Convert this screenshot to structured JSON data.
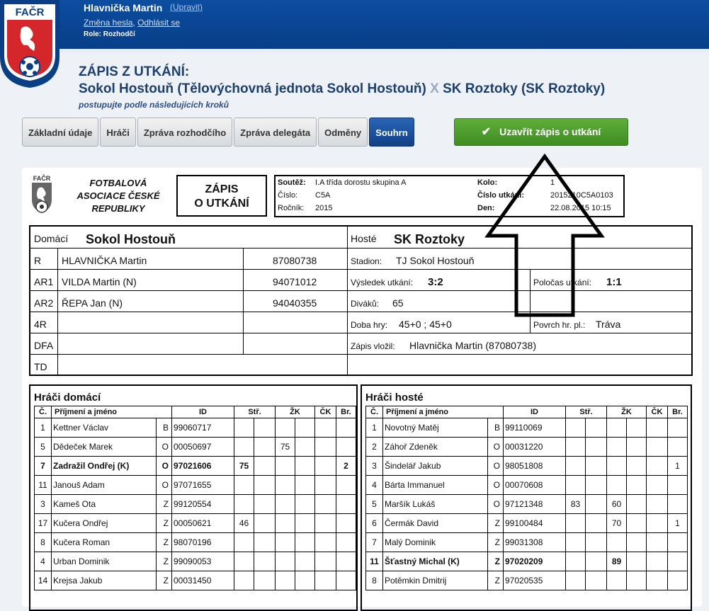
{
  "user": {
    "name": "Hlavnička Martin",
    "edit": "(Upravit)",
    "change_password": "Změna hesla",
    "logout": "Odhlásit se",
    "role": "Role: Rozhodčí",
    "sep": ","
  },
  "logo": {
    "text": "FAČR"
  },
  "page": {
    "title": "ZÁPIS Z UTKÁNÍ:",
    "home": "Sokol Hostouň (Tělovýchovná jednota Sokol Hostouň)",
    "x": "X",
    "away": "SK Roztoky (SK Roztoky)",
    "hint": "postupujte podle následujících kroků"
  },
  "tabs": [
    "Základní údaje",
    "Hráči",
    "Zpráva rozhodčího",
    "Zpráva delegáta",
    "Odměny",
    "Souhrn"
  ],
  "close_button": "Uzavřít zápis o utkání",
  "doc": {
    "fed": "FOTBALOVÁ ASOCIACE ČESKÉ REPUBLIKY",
    "zapis1": "ZÁPIS",
    "zapis2": "O UTKÁNÍ",
    "soutez_l": "Soutěž:",
    "soutez": "I.A třída dorostu skupina A",
    "cislo_l": "Číslo:",
    "cislo": "C5A",
    "rocnik_l": "Ročník:",
    "rocnik": "2015",
    "kolo_l": "Kolo:",
    "kolo": "1",
    "cislo_utkani_l": "Číslo utkání:",
    "cislo_utkani": "2015210C5A0103",
    "den_l": "Den:",
    "den": "22.08.2015 10:15",
    "domaci_l": "Domácí",
    "domaci": "Sokol Hostouň",
    "hoste_l": "Hosté",
    "hoste": "SK Roztoky",
    "officials": [
      {
        "role": "R",
        "name": "HLAVNIČKA Martin",
        "id": "87080738"
      },
      {
        "role": "AR1",
        "name": "VILDA Martin (N)",
        "id": "94071012"
      },
      {
        "role": "AR2",
        "name": "ŘEPA Jan (N)",
        "id": "94040355"
      },
      {
        "role": "4R",
        "name": "",
        "id": ""
      },
      {
        "role": "DFA",
        "name": "",
        "id": ""
      },
      {
        "role": "TD",
        "name": "",
        "id": ""
      }
    ],
    "stadion_l": "Stadion:",
    "stadion": "TJ Sokol Hostouň",
    "vysledek_l": "Výsledek utkání:",
    "vysledek": "3:2",
    "polocas_l": "Poločas utkání:",
    "polocas": "1:1",
    "divaku_l": "Diváků:",
    "divaku": "65",
    "doba_l": "Doba hry:",
    "doba": "45+0 ; 45+0",
    "povrch_l": "Povrch hr. pl.:",
    "povrch": "Tráva",
    "vlozil_l": "Zápis vložil:",
    "vlozil": "Hlavnička Martin (87080738)"
  },
  "home_players": {
    "title": "Hráči domácí",
    "headers": [
      "Č.",
      "Příjmení a jméno",
      "ID",
      "Stř.",
      "",
      "ŽK",
      "",
      "ČK",
      "Br."
    ],
    "rows": [
      [
        "1",
        "Kettner Václav",
        "B",
        "99060717",
        "",
        "",
        "",
        "",
        "",
        ""
      ],
      [
        "5",
        "Dědeček Marek",
        "O",
        "00050697",
        "",
        "",
        "75",
        "",
        "",
        ""
      ],
      [
        "7",
        "Zadražil Ondřej (K)",
        "O",
        "97021606",
        "75",
        "",
        "",
        "",
        "",
        "2"
      ],
      [
        "11",
        "Janouš Adam",
        "O",
        "97071655",
        "",
        "",
        "",
        "",
        "",
        ""
      ],
      [
        "3",
        "Kameš Ota",
        "Z",
        "99120554",
        "",
        "",
        "",
        "",
        "",
        ""
      ],
      [
        "17",
        "Kučera Ondřej",
        "Z",
        "00050621",
        "46",
        "",
        "",
        "",
        "",
        ""
      ],
      [
        "8",
        "Kučera Roman",
        "Z",
        "98070196",
        "",
        "",
        "",
        "",
        "",
        ""
      ],
      [
        "4",
        "Urban Dominik",
        "Z",
        "99090053",
        "",
        "",
        "",
        "",
        "",
        ""
      ],
      [
        "14",
        "Krejsa Jakub",
        "Z",
        "00031450",
        "",
        "",
        "",
        "",
        "",
        ""
      ]
    ]
  },
  "away_players": {
    "title": "Hráči hosté",
    "headers": [
      "Č.",
      "Příjmení a jméno",
      "ID",
      "Stř.",
      "",
      "ŽK",
      "",
      "ČK",
      "Br."
    ],
    "rows": [
      [
        "1",
        "Novotný Matěj",
        "B",
        "99110069",
        "",
        "",
        "",
        "",
        "",
        ""
      ],
      [
        "2",
        "Záhoř Zdeněk",
        "O",
        "00031220",
        "",
        "",
        "",
        "",
        "",
        ""
      ],
      [
        "3",
        "Šindelář Jakub",
        "O",
        "98051808",
        "",
        "",
        "",
        "",
        "",
        "1"
      ],
      [
        "4",
        "Bárta Immanuel",
        "O",
        "00070608",
        "",
        "",
        "",
        "",
        "",
        ""
      ],
      [
        "5",
        "Maršík Lukáš",
        "O",
        "97121348",
        "83",
        "",
        "60",
        "",
        "",
        ""
      ],
      [
        "6",
        "Čermák David",
        "Z",
        "99100484",
        "",
        "",
        "70",
        "",
        "",
        "1"
      ],
      [
        "7",
        "Malý Dominik",
        "Z",
        "99031308",
        "",
        "",
        "",
        "",
        "",
        ""
      ],
      [
        "11",
        "Šťastný Michal (K)",
        "Z",
        "97020209",
        "",
        "",
        "89",
        "",
        "",
        ""
      ],
      [
        "8",
        "Potěmkin Dmitrij",
        "Z",
        "97020535",
        "",
        "",
        "",
        "",
        "",
        ""
      ]
    ]
  },
  "captain_rows": {
    "home": 2,
    "away": 7
  }
}
